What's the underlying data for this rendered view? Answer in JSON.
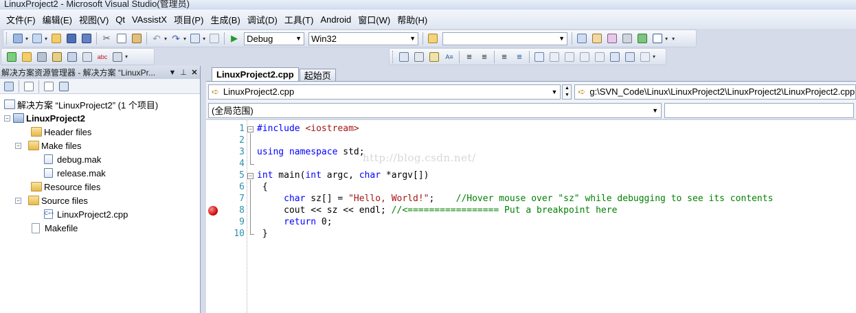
{
  "window": {
    "title": "LinuxProject2 - Microsoft Visual Studio(管理员)"
  },
  "menu": [
    "文件(F)",
    "编辑(E)",
    "视图(V)",
    "Qt",
    "VAssistX",
    "项目(P)",
    "生成(B)",
    "调试(D)",
    "工具(T)",
    "Android",
    "窗口(W)",
    "帮助(H)"
  ],
  "toolbar": {
    "configuration": "Debug",
    "platform": "Win32",
    "find_value": ""
  },
  "solution_explorer": {
    "title": "解决方案资源管理器 - 解决方案 “LinuxPr...",
    "pin_icon": "pin-icon",
    "close_icon": "close-icon",
    "solution": "解决方案 “LinuxProject2” (1 个项目)",
    "project": "LinuxProject2",
    "items": {
      "header_files": "Header files",
      "make_files": "Make files",
      "debug_mak": "debug.mak",
      "release_mak": "release.mak",
      "resource_files": "Resource files",
      "source_files": "Source files",
      "linux_cpp": "LinuxProject2.cpp",
      "makefile": "Makefile"
    }
  },
  "editor": {
    "tabs": [
      "LinuxProject2.cpp",
      "起始页"
    ],
    "nav_file": "LinuxProject2.cpp",
    "nav_path": "g:\\SVN_Code\\Linux\\LinuxProject2\\LinuxProject2\\LinuxProject2.cpp",
    "scope": "(全局范围)",
    "watermark": "http://blog.csdn.net/",
    "line_numbers": [
      "1",
      "2",
      "3",
      "4",
      "5",
      "6",
      "7",
      "8",
      "9",
      "10"
    ],
    "breakpoint_line": "8",
    "code": {
      "l1_kw": "#include",
      "l1_str": " <iostream>",
      "l3_kw1": "using",
      "l3_sp1": " ",
      "l3_kw2": "namespace",
      "l3_rest": " std;",
      "l5_kw1": "int",
      "l5_mid1": " main(",
      "l5_kw2": "int",
      "l5_mid2": " argc, ",
      "l5_kw3": "char",
      "l5_rest": " *argv[])",
      "l6": " {",
      "l7_indent": "     ",
      "l7_kw": "char",
      "l7_mid": " sz[] = ",
      "l7_str": "\"Hello, World!\"",
      "l7_semi": ";    ",
      "l7_cmt": "//Hover mouse over \"sz\" while debugging to see its contents",
      "l8_code": "     cout << sz << endl; ",
      "l8_cmt": "//<================= Put a breakpoint here",
      "l9_indent": "     ",
      "l9_kw": "return",
      "l9_rest": " 0;",
      "l10": " }"
    }
  },
  "colors": {
    "keyword": "#0000ff",
    "string": "#a31515",
    "comment": "#008000",
    "line_number": "#2b91af",
    "breakpoint": "#c40000"
  }
}
